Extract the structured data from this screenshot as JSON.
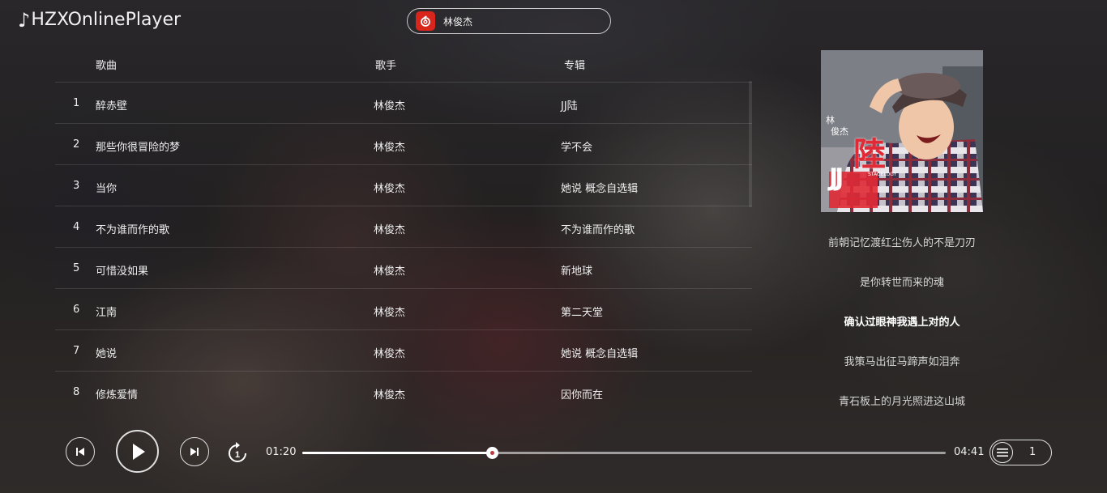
{
  "app": {
    "title": "HZXOnlinePlayer",
    "logo_icon": "music-note-icon"
  },
  "search": {
    "source_icon": "netease-music-icon",
    "value": "林俊杰"
  },
  "table": {
    "headers": {
      "title": "歌曲",
      "artist": "歌手",
      "album": "专辑"
    },
    "rows": [
      {
        "index": "1",
        "title": "醉赤壁",
        "artist": "林俊杰",
        "album": "JJ陆"
      },
      {
        "index": "2",
        "title": "那些你很冒险的梦",
        "artist": "林俊杰",
        "album": "学不会"
      },
      {
        "index": "3",
        "title": "当你",
        "artist": "林俊杰",
        "album": "她说 概念自选辑"
      },
      {
        "index": "4",
        "title": "不为谁而作的歌",
        "artist": "林俊杰",
        "album": "不为谁而作的歌"
      },
      {
        "index": "5",
        "title": "可惜没如果",
        "artist": "林俊杰",
        "album": "新地球"
      },
      {
        "index": "6",
        "title": "江南",
        "artist": "林俊杰",
        "album": "第二天堂"
      },
      {
        "index": "7",
        "title": "她说",
        "artist": "林俊杰",
        "album": "她说 概念自选辑"
      },
      {
        "index": "8",
        "title": "修炼爱情",
        "artist": "林俊杰",
        "album": "因你而在"
      }
    ]
  },
  "now_playing": {
    "cover_art": {
      "name_top": "林",
      "name_bottom": "俊杰",
      "album_mark": "陸",
      "jj": "JJ",
      "subtitle": "STAGELOGY"
    },
    "lyrics": [
      {
        "text": "前朝记忆渡红尘伤人的不是刀刃",
        "active": false
      },
      {
        "text": "是你转世而来的魂",
        "active": false
      },
      {
        "text": "确认过眼神我遇上对的人",
        "active": true
      },
      {
        "text": "我策马出征马蹄声如泪奔",
        "active": false
      },
      {
        "text": "青石板上的月光照进这山城",
        "active": false
      }
    ]
  },
  "player": {
    "current_time": "01:20",
    "duration": "04:41",
    "progress_fraction": 0.295,
    "playlist_count": "1",
    "icons": [
      "prev-icon",
      "play-icon",
      "next-icon",
      "repeat-one-icon",
      "playlist-icon"
    ]
  },
  "colors": {
    "accent_red": "#d8261c",
    "text": "#f0f0f0"
  }
}
